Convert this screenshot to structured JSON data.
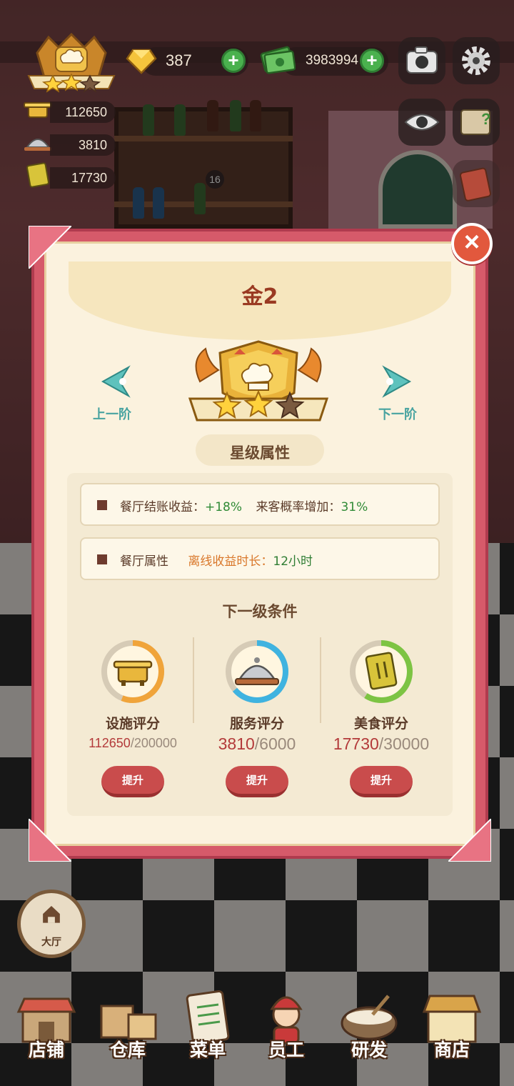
{
  "hud": {
    "gems": "387",
    "cash": "3983994",
    "facility_score": "112650",
    "service_score": "3810",
    "food_score": "17730",
    "shelf_badge": "16"
  },
  "dialog": {
    "title": "金2",
    "prev_label": "上一阶",
    "next_label": "下一阶",
    "stars_filled": 2,
    "stars_total": 3,
    "star_section_title": "星级属性",
    "attributes": [
      {
        "label": "餐厅结账收益：",
        "value": "+18%",
        "label2": "来客概率增加：",
        "value2": "31%"
      },
      {
        "label": "餐厅属性",
        "label2": "离线收益时长：",
        "value2": "12小时"
      }
    ],
    "next_level_title": "下一级条件",
    "conditions": [
      {
        "label": "设施评分",
        "current": "112650",
        "max": "/200000",
        "button": "提升",
        "progress": 0.56,
        "ring_color": "#f0a43a",
        "icon": "hot-pot-icon"
      },
      {
        "label": "服务评分",
        "current": "3810",
        "max": "/6000",
        "button": "提升",
        "progress": 0.64,
        "ring_color": "#3fb3e0",
        "icon": "serving-cloche-icon"
      },
      {
        "label": "美食评分",
        "current": "17730",
        "max": "/30000",
        "button": "提升",
        "progress": 0.59,
        "ring_color": "#7dc443",
        "icon": "recipe-book-icon"
      }
    ]
  },
  "bottom_nav": {
    "hall": "大厅",
    "items": [
      "店铺",
      "仓库",
      "菜单",
      "员工",
      "研发",
      "商店"
    ]
  },
  "colors": {
    "dialog_frame": "#d65a6a",
    "dialog_bg": "#fbf2de",
    "title": "#9a3a22",
    "green_value": "#2f8a35",
    "orange_value": "#d9772a",
    "button_red": "#c94c4c"
  }
}
